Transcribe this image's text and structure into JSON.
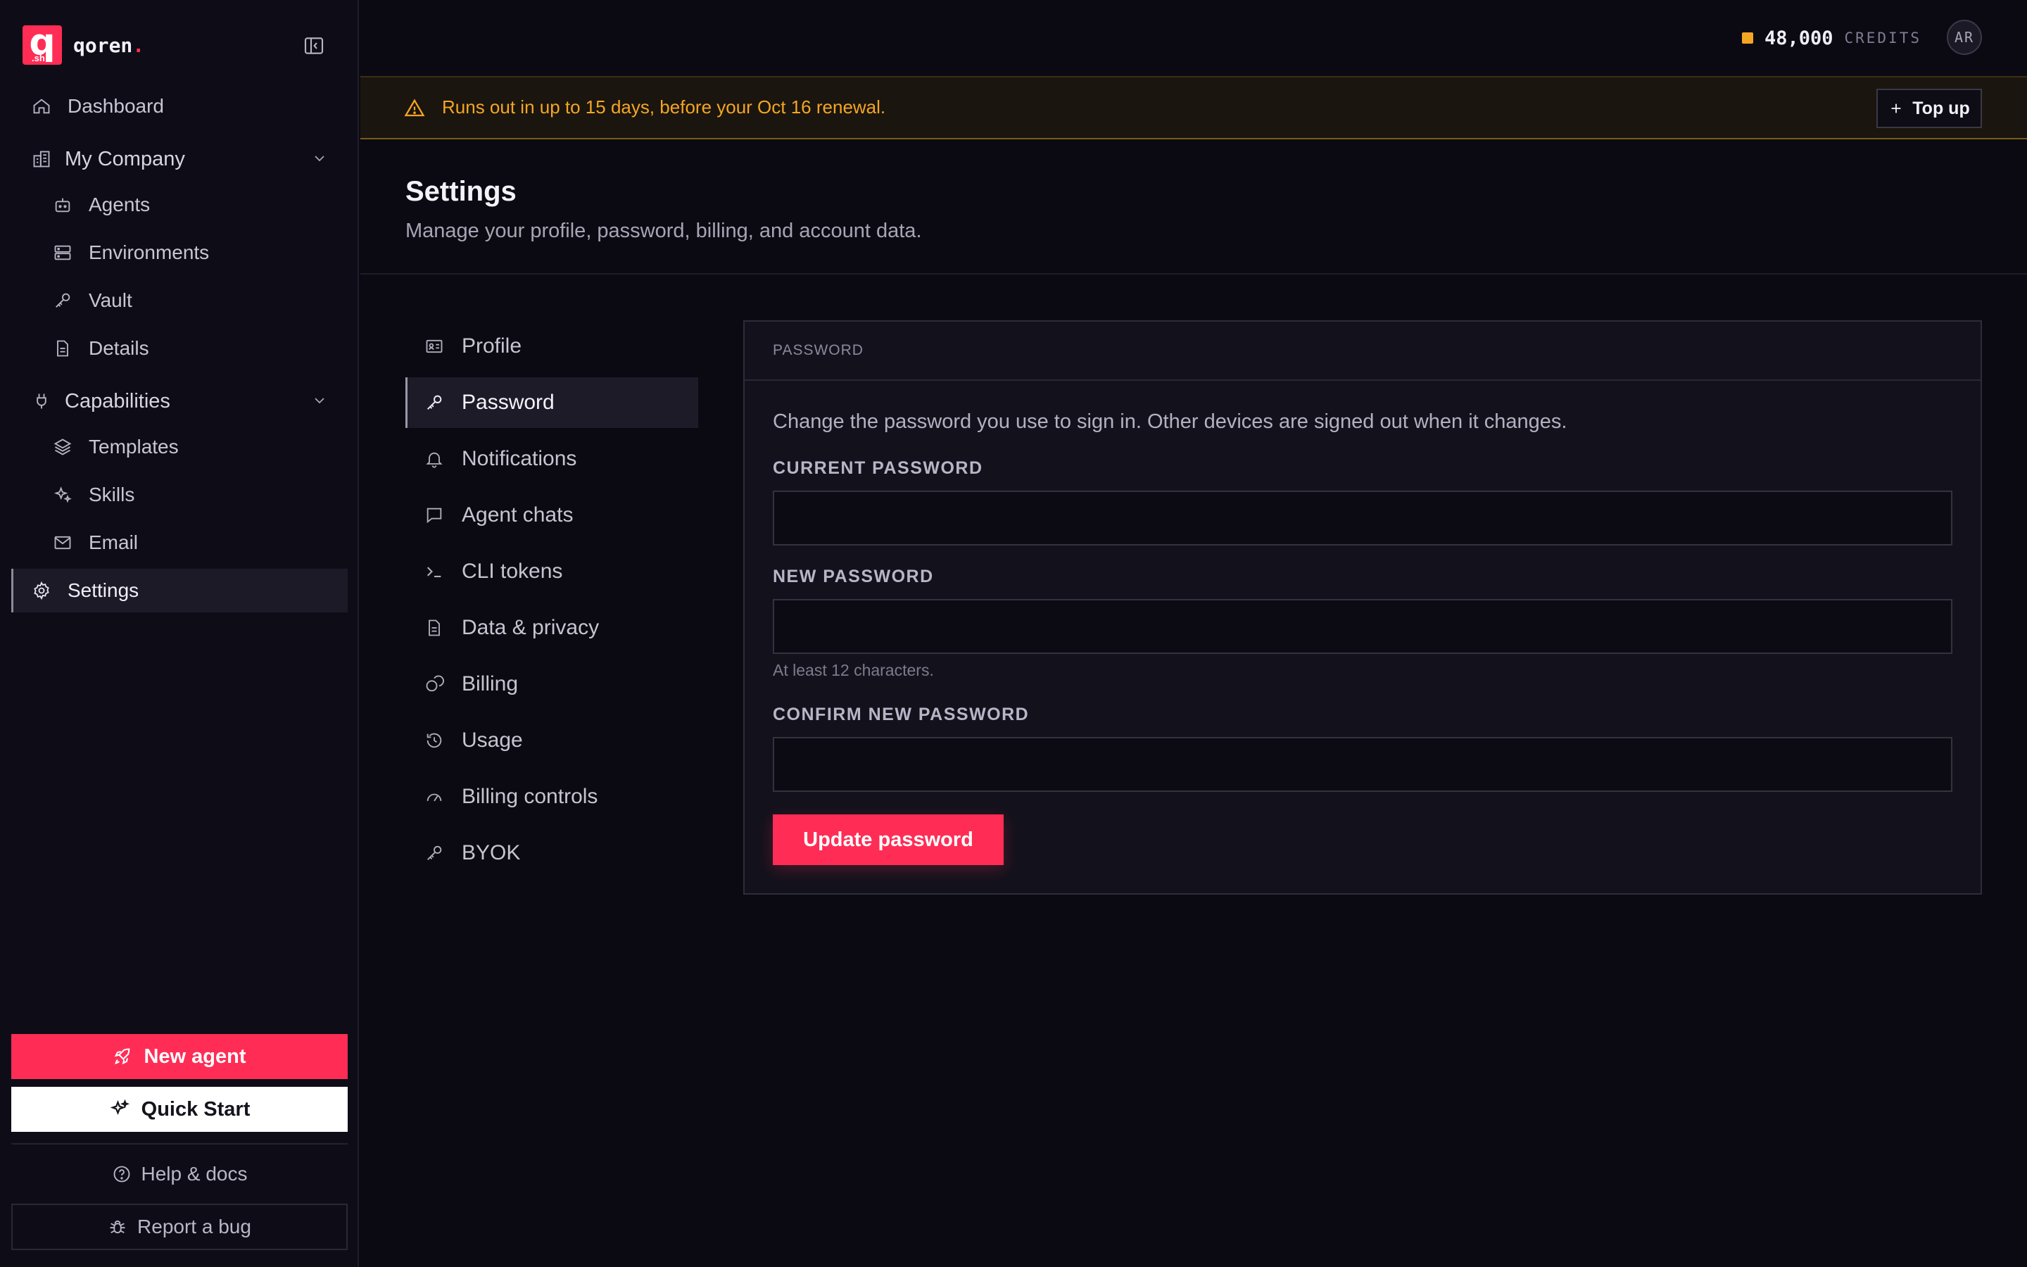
{
  "brand": {
    "name": "qoren",
    "dot": ".",
    "logo_letter": "q",
    "logo_sub": ".sh"
  },
  "sidebar": {
    "dashboard": "Dashboard",
    "company_group": "My Company",
    "company_items": [
      "Agents",
      "Environments",
      "Vault",
      "Details"
    ],
    "capabilities_group": "Capabilities",
    "capability_items": [
      "Templates",
      "Skills",
      "Email"
    ],
    "settings": "Settings",
    "new_agent": "New agent",
    "quick_start": "Quick Start",
    "help": "Help & docs",
    "report_bug": "Report a bug"
  },
  "topbar": {
    "credits_value": "48,000",
    "credits_label": "CREDITS",
    "avatar_initials": "AR",
    "credit_dot_color": "#f5a524"
  },
  "banner": {
    "text": "Runs out in up to 15 days, before your Oct 16 renewal.",
    "topup_label": "Top up",
    "color": "#f5a524"
  },
  "page": {
    "title": "Settings",
    "subtitle": "Manage your profile, password, billing, and account data."
  },
  "settings_nav": {
    "items": [
      "Profile",
      "Password",
      "Notifications",
      "Agent chats",
      "CLI tokens",
      "Data & privacy",
      "Billing",
      "Usage",
      "Billing controls",
      "BYOK"
    ],
    "icons": [
      "id-card-icon",
      "key-icon",
      "bell-icon",
      "chat-icon",
      "terminal-icon",
      "document-icon",
      "coins-icon",
      "history-icon",
      "gauge-icon",
      "key-icon"
    ],
    "active": "Password"
  },
  "panel": {
    "header": "PASSWORD",
    "description": "Change the password you use to sign in. Other devices are signed out when it changes.",
    "current_label": "CURRENT PASSWORD",
    "current_value": "",
    "new_label": "NEW PASSWORD",
    "new_value": "",
    "new_hint": "At least 12 characters.",
    "confirm_label": "CONFIRM NEW PASSWORD",
    "confirm_value": "",
    "submit_label": "Update password"
  },
  "colors": {
    "accent": "#ff2d55",
    "background": "#0b0a12",
    "warning": "#f5a524"
  }
}
